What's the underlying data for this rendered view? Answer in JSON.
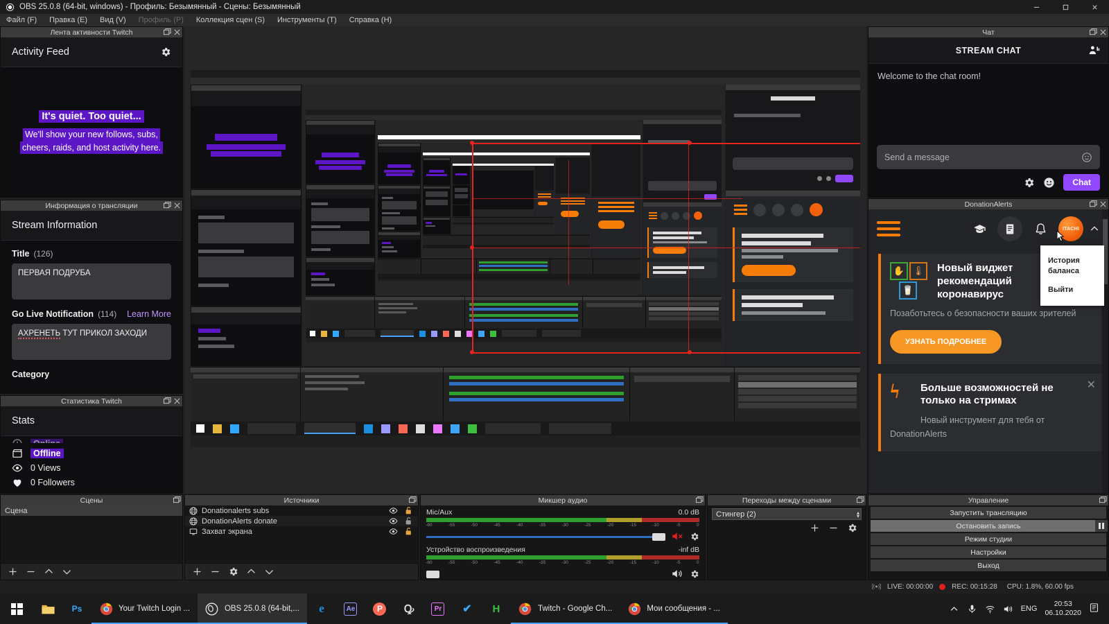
{
  "window": {
    "title": "OBS 25.0.8 (64-bit, windows) - Профиль: Безымянный - Сцены: Безымянный",
    "minimize": "–",
    "maximize": "❐",
    "close": "✕"
  },
  "menu": [
    {
      "label": "Файл (F)",
      "disabled": false
    },
    {
      "label": "Правка (E)",
      "disabled": false
    },
    {
      "label": "Вид (V)",
      "disabled": false
    },
    {
      "label": "Профиль (P)",
      "disabled": true
    },
    {
      "label": "Коллекция сцен (S)",
      "disabled": false
    },
    {
      "label": "Инструменты (T)",
      "disabled": false
    },
    {
      "label": "Справка (H)",
      "disabled": false
    }
  ],
  "activity_feed": {
    "dock_title": "Лента активности Twitch",
    "panel_title": "Activity Feed",
    "headline": "It's quiet. Too quiet...",
    "sub_line1": "We'll show your new follows, subs,",
    "sub_line2": "cheers, raids, and host activity here."
  },
  "stream_info": {
    "dock_title": "Информация о трансляции",
    "panel_title": "Stream Information",
    "title_label": "Title",
    "title_count": "(126)",
    "title_value": "ПЕРВАЯ ПОДРУБА",
    "golive_label": "Go Live Notification",
    "golive_count": "(114)",
    "learn_more": "Learn More",
    "golive_spell": "АХРЕНЕТЬ",
    "golive_rest": " ТУТ ПРИКОЛ ЗАХОДИ",
    "category_label": "Category"
  },
  "twitch_stats": {
    "dock_title": "Статистика Twitch",
    "panel_title": "Stats",
    "rows": [
      {
        "icon": "clapperboard-icon",
        "label": "Offline",
        "highlight": true
      },
      {
        "icon": "eye-icon",
        "label": "0 Views",
        "highlight": false
      },
      {
        "icon": "heart-icon",
        "label": "0 Followers",
        "highlight": false
      }
    ]
  },
  "chat": {
    "dock_title": "Чат",
    "header": "STREAM CHAT",
    "welcome": "Welcome to the chat room!",
    "input_placeholder": "Send a message",
    "send_button": "Chat"
  },
  "donation_alerts": {
    "dock_title": "DonationAlerts",
    "avatar_label": "ITACHI",
    "menu": [
      "История баланса",
      "Выйти"
    ],
    "card1": {
      "title_l1": "Новый виджет",
      "title_l2": "рекомендаций",
      "title_l3": "коронавирус",
      "body": "Позаботьтесь о безопасности ваших зрителей",
      "cta": "УЗНАТЬ ПОДРОБНЕЕ"
    },
    "card2": {
      "title_l1": "Больше возможностей не",
      "title_l2": "только на стримах",
      "body_l1": "Новый инструмент для тебя от",
      "body_l2": "DonationAlerts"
    }
  },
  "scenes": {
    "dock_title": "Сцены",
    "items": [
      "Сцена"
    ]
  },
  "sources": {
    "dock_title": "Источники",
    "items": [
      {
        "name": "Donationalerts subs",
        "icon": "browser-icon"
      },
      {
        "name": "DonationAlerts donate",
        "icon": "browser-icon"
      },
      {
        "name": "Захват экрана",
        "icon": "display-icon"
      }
    ]
  },
  "mixer": {
    "dock_title": "Микшер аудио",
    "ticks": [
      "-60",
      "-55",
      "-50",
      "-45",
      "-40",
      "-35",
      "-30",
      "-25",
      "-20",
      "-15",
      "-10",
      "-5",
      "0"
    ],
    "channels": [
      {
        "name": "Mic/Aux",
        "db": "0.0 dB",
        "muted": true
      },
      {
        "name": "Устройство воспроизведения",
        "db": "-inf dB",
        "muted": false
      }
    ]
  },
  "transitions": {
    "dock_title": "Переходы между сценами",
    "selected": "Стингер (2)"
  },
  "controls": {
    "dock_title": "Управление",
    "buttons": [
      {
        "label": "Запустить трансляцию",
        "active": false,
        "pause": false
      },
      {
        "label": "Остановить запись",
        "active": true,
        "pause": true
      },
      {
        "label": "Режим студии",
        "active": false,
        "pause": false
      },
      {
        "label": "Настройки",
        "active": false,
        "pause": false
      },
      {
        "label": "Выход",
        "active": false,
        "pause": false
      }
    ]
  },
  "status_bar": {
    "live": "LIVE: 00:00:00",
    "rec": "REC: 00:15:28",
    "cpu": "CPU: 1.8%, 60.00 fps"
  },
  "taskbar": {
    "tasks": [
      {
        "label": "Your Twitch Login ...",
        "icon": "chrome-icon",
        "active": false,
        "running": true
      },
      {
        "label": "OBS 25.0.8 (64-bit,...",
        "icon": "obs-icon",
        "active": true,
        "running": true
      },
      {
        "label": "Twitch - Google Ch...",
        "icon": "chrome-icon",
        "active": false,
        "running": true
      },
      {
        "label": "Мои сообщения - ...",
        "icon": "chrome-icon",
        "active": false,
        "running": true
      }
    ],
    "pinned": [
      {
        "icon": "explorer-icon",
        "glyph": "",
        "color": "#e8b53f"
      },
      {
        "icon": "photoshop-icon",
        "glyph": "Ps",
        "color": "#31a8ff"
      }
    ],
    "tray_apps": [
      {
        "icon": "edge-icon",
        "glyph": "e",
        "color": "#1a8fe0"
      },
      {
        "icon": "after-effects-icon",
        "glyph": "Ae",
        "color": "#9999ff"
      },
      {
        "icon": "patreon-icon",
        "glyph": "P",
        "color": "#f96854"
      },
      {
        "icon": "obs-alt-icon",
        "glyph": "Q",
        "color": "#dddddd"
      },
      {
        "icon": "premiere-icon",
        "glyph": "Pr",
        "color": "#ea77ff"
      },
      {
        "icon": "checkmark-icon",
        "glyph": "✔",
        "color": "#3da5f4"
      },
      {
        "icon": "hitfilm-icon",
        "glyph": "H",
        "color": "#3ec03e"
      }
    ],
    "language": "ENG",
    "time": "20:53",
    "date": "06.10.2020"
  },
  "colors": {
    "twitch_purple": "#5c16c5",
    "twitch_button": "#9147ff",
    "donation_orange": "#f57d07",
    "record_red": "#e02020",
    "selection_red": "#e8221c"
  }
}
